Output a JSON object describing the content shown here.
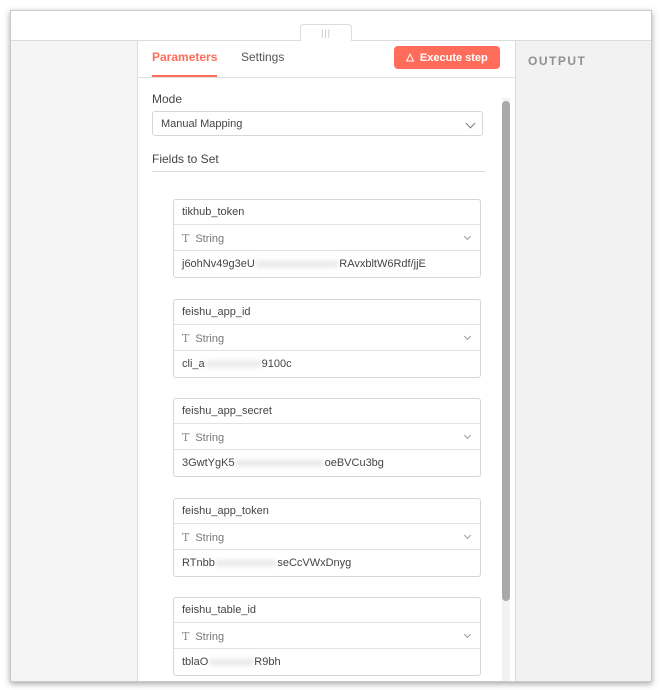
{
  "output_panel": {
    "title": "OUTPUT"
  },
  "tabs": {
    "parameters": "Parameters",
    "settings": "Settings"
  },
  "execute_button": {
    "label": "Execute step",
    "icon": "flask-icon",
    "color": "#ff6d5a"
  },
  "mode": {
    "label": "Mode",
    "value": "Manual Mapping"
  },
  "fields_label": "Fields to Set",
  "fields": [
    {
      "name": "tikhub_token",
      "type": "String",
      "value_start": "j6ohNv49g3eU",
      "value_hidden": "xxxxxxxxxxxxxxx",
      "value_end": "RAvxbltW6Rdf/jjE"
    },
    {
      "name": "feishu_app_id",
      "type": "String",
      "value_start": "cli_a",
      "value_hidden": "xxxxxxxxxx",
      "value_end": "9100c"
    },
    {
      "name": "feishu_app_secret",
      "type": "String",
      "value_start": "3GwtYgK5",
      "value_hidden": "xxxxxxxxxxxxxxxx",
      "value_end": "oeBVCu3bg"
    },
    {
      "name": "feishu_app_token",
      "type": "String",
      "value_start": "RTnbb",
      "value_hidden": "xxxxxxxxxxx",
      "value_end": "seCcVWxDnyg"
    },
    {
      "name": "feishu_table_id",
      "type": "String",
      "value_start": "tblaO",
      "value_hidden": "xxxxxxxx",
      "value_end": "R9bh"
    }
  ]
}
